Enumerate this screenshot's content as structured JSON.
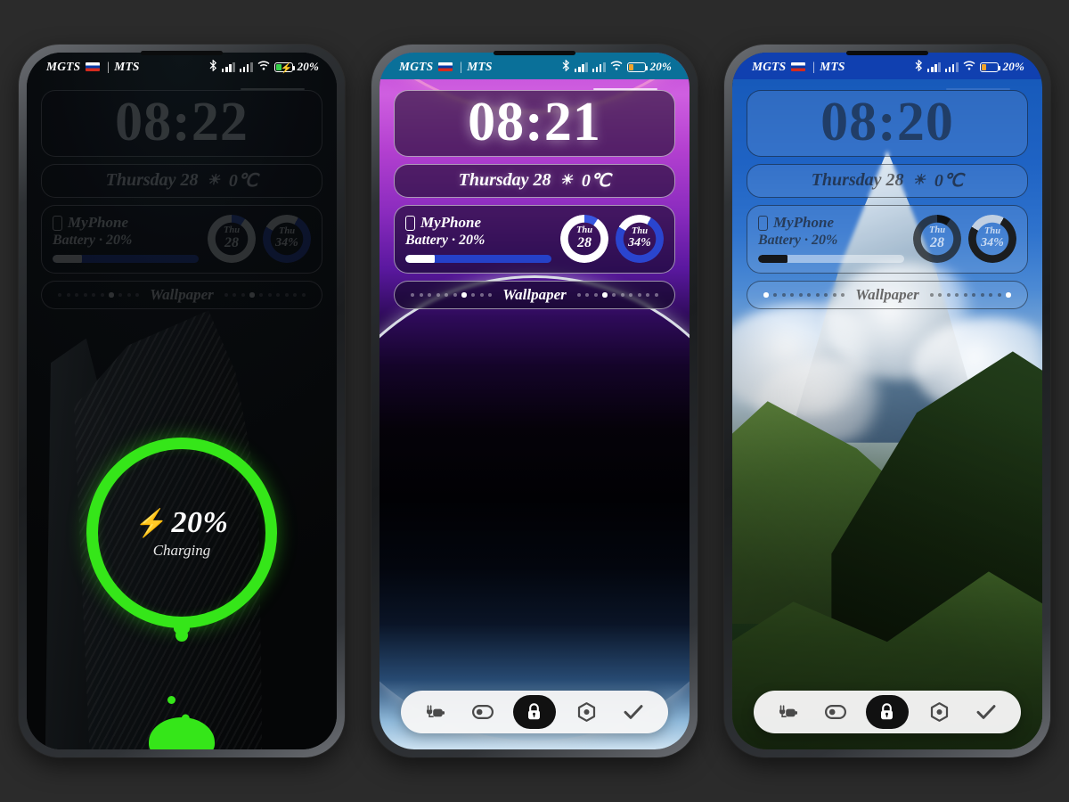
{
  "scene": {
    "background_color": "#2b2b2b",
    "phone_count": 3
  },
  "shared": {
    "carrier_primary": "MGTS",
    "carrier_separator": "|",
    "carrier_secondary": "MTS",
    "flag_icon": "russia-flag-icon",
    "battery_percent_label": "20%",
    "status_icons": [
      "bluetooth-icon",
      "signal-bars-sim1-icon",
      "signal-bars-sim2-icon",
      "wifi-icon",
      "battery-icon"
    ],
    "widgets": {
      "date_text": "Thursday 28",
      "weather_icon": "sun-icon",
      "weather_temp": "0℃",
      "device_name": "MyPhone",
      "device_icon": "phone-glyph-icon",
      "battery_line": "Battery · 20%",
      "battery_fill_percent": 20,
      "gauge_left": {
        "top": "Thu",
        "value": "28",
        "arc_percent": 9,
        "ring_color": "#ffffff",
        "accent_color": "#3858e0"
      },
      "gauge_right": {
        "top": "Thu",
        "value": "34%",
        "arc_percent": 34,
        "ring_color": "#2a45cf",
        "accent_color": "#ffffff"
      },
      "wallpaper_label": "Wallpaper"
    },
    "dock": {
      "items": [
        {
          "name": "charger-plug-icon",
          "label": "Charger",
          "active": false
        },
        {
          "name": "toggle-switch-icon",
          "label": "Toggle",
          "active": false
        },
        {
          "name": "lock-icon",
          "label": "Lock",
          "active": true
        },
        {
          "name": "settings-hexagon-icon",
          "label": "Settings",
          "active": false
        },
        {
          "name": "check-icon",
          "label": "Apply",
          "active": false
        }
      ]
    }
  },
  "phones": [
    {
      "id": "phone-1",
      "wallpaper": "night-building",
      "statusbar_style": "transparent-dark",
      "clock": "08:22",
      "screen_dimmed": true,
      "has_dock": false,
      "charging_overlay": {
        "percent_label": "20%",
        "bolt_icon": "lightning-bolt-icon",
        "state_label": "Charging",
        "ring_color": "#35e619"
      }
    },
    {
      "id": "phone-2",
      "wallpaper": "purple-gradient-arcs",
      "statusbar_style": "teal",
      "statusbar_color": "#0a7099",
      "clock": "08:21",
      "screen_dimmed": false,
      "has_dock": true,
      "charging_overlay": null
    },
    {
      "id": "phone-3",
      "wallpaper": "mountain-landscape",
      "statusbar_style": "blue",
      "statusbar_color": "#1040b0",
      "clock": "08:20",
      "screen_dimmed": false,
      "has_dock": true,
      "charging_overlay": null
    }
  ]
}
